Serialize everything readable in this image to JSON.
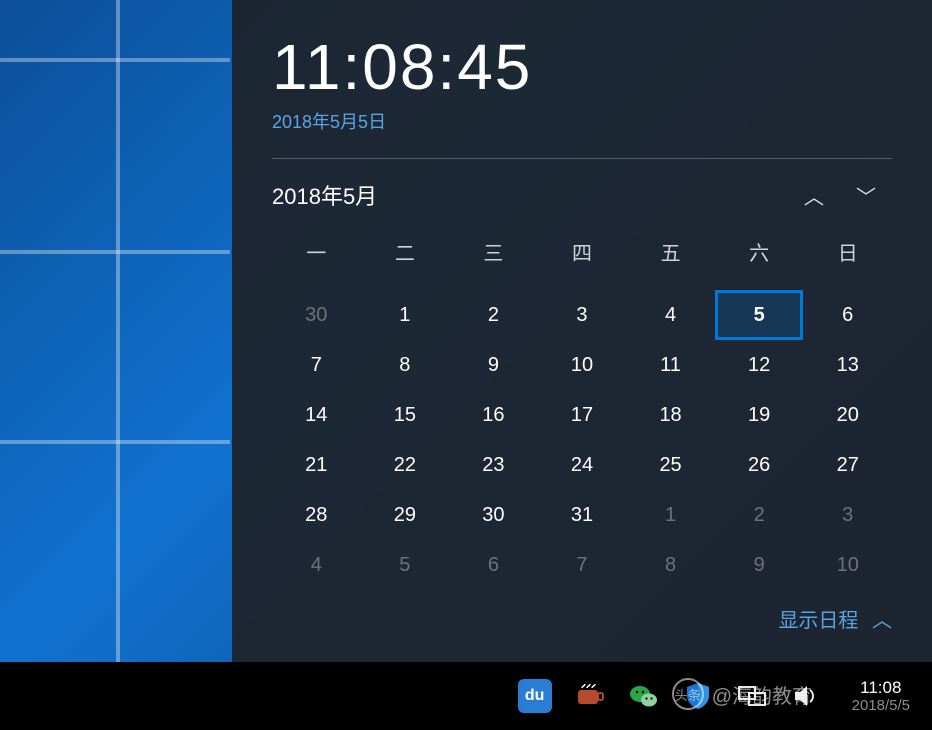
{
  "clock": {
    "time": "11:08:45",
    "date": "2018年5月5日"
  },
  "calendar": {
    "month_label": "2018年5月",
    "dow": [
      "一",
      "二",
      "三",
      "四",
      "五",
      "六",
      "日"
    ],
    "weeks": [
      [
        {
          "d": "30",
          "out": true
        },
        {
          "d": "1"
        },
        {
          "d": "2"
        },
        {
          "d": "3"
        },
        {
          "d": "4"
        },
        {
          "d": "5",
          "today": true
        },
        {
          "d": "6"
        }
      ],
      [
        {
          "d": "7"
        },
        {
          "d": "8"
        },
        {
          "d": "9"
        },
        {
          "d": "10"
        },
        {
          "d": "11"
        },
        {
          "d": "12"
        },
        {
          "d": "13"
        }
      ],
      [
        {
          "d": "14"
        },
        {
          "d": "15"
        },
        {
          "d": "16"
        },
        {
          "d": "17"
        },
        {
          "d": "18"
        },
        {
          "d": "19"
        },
        {
          "d": "20"
        }
      ],
      [
        {
          "d": "21"
        },
        {
          "d": "22"
        },
        {
          "d": "23"
        },
        {
          "d": "24"
        },
        {
          "d": "25"
        },
        {
          "d": "26"
        },
        {
          "d": "27"
        }
      ],
      [
        {
          "d": "28"
        },
        {
          "d": "29"
        },
        {
          "d": "30"
        },
        {
          "d": "31"
        },
        {
          "d": "1",
          "out": true
        },
        {
          "d": "2",
          "out": true
        },
        {
          "d": "3",
          "out": true
        }
      ],
      [
        {
          "d": "4",
          "out": true
        },
        {
          "d": "5",
          "out": true
        },
        {
          "d": "6",
          "out": true
        },
        {
          "d": "7",
          "out": true
        },
        {
          "d": "8",
          "out": true
        },
        {
          "d": "9",
          "out": true
        },
        {
          "d": "10",
          "out": true
        }
      ]
    ],
    "agenda_label": "显示日程"
  },
  "tray": {
    "du_label": "du",
    "toutiao_label": "头条",
    "clock_time": "11:08",
    "clock_date": "2018/5/5"
  },
  "watermark": {
    "logo_text": "头条",
    "text": "@海韵教育"
  }
}
